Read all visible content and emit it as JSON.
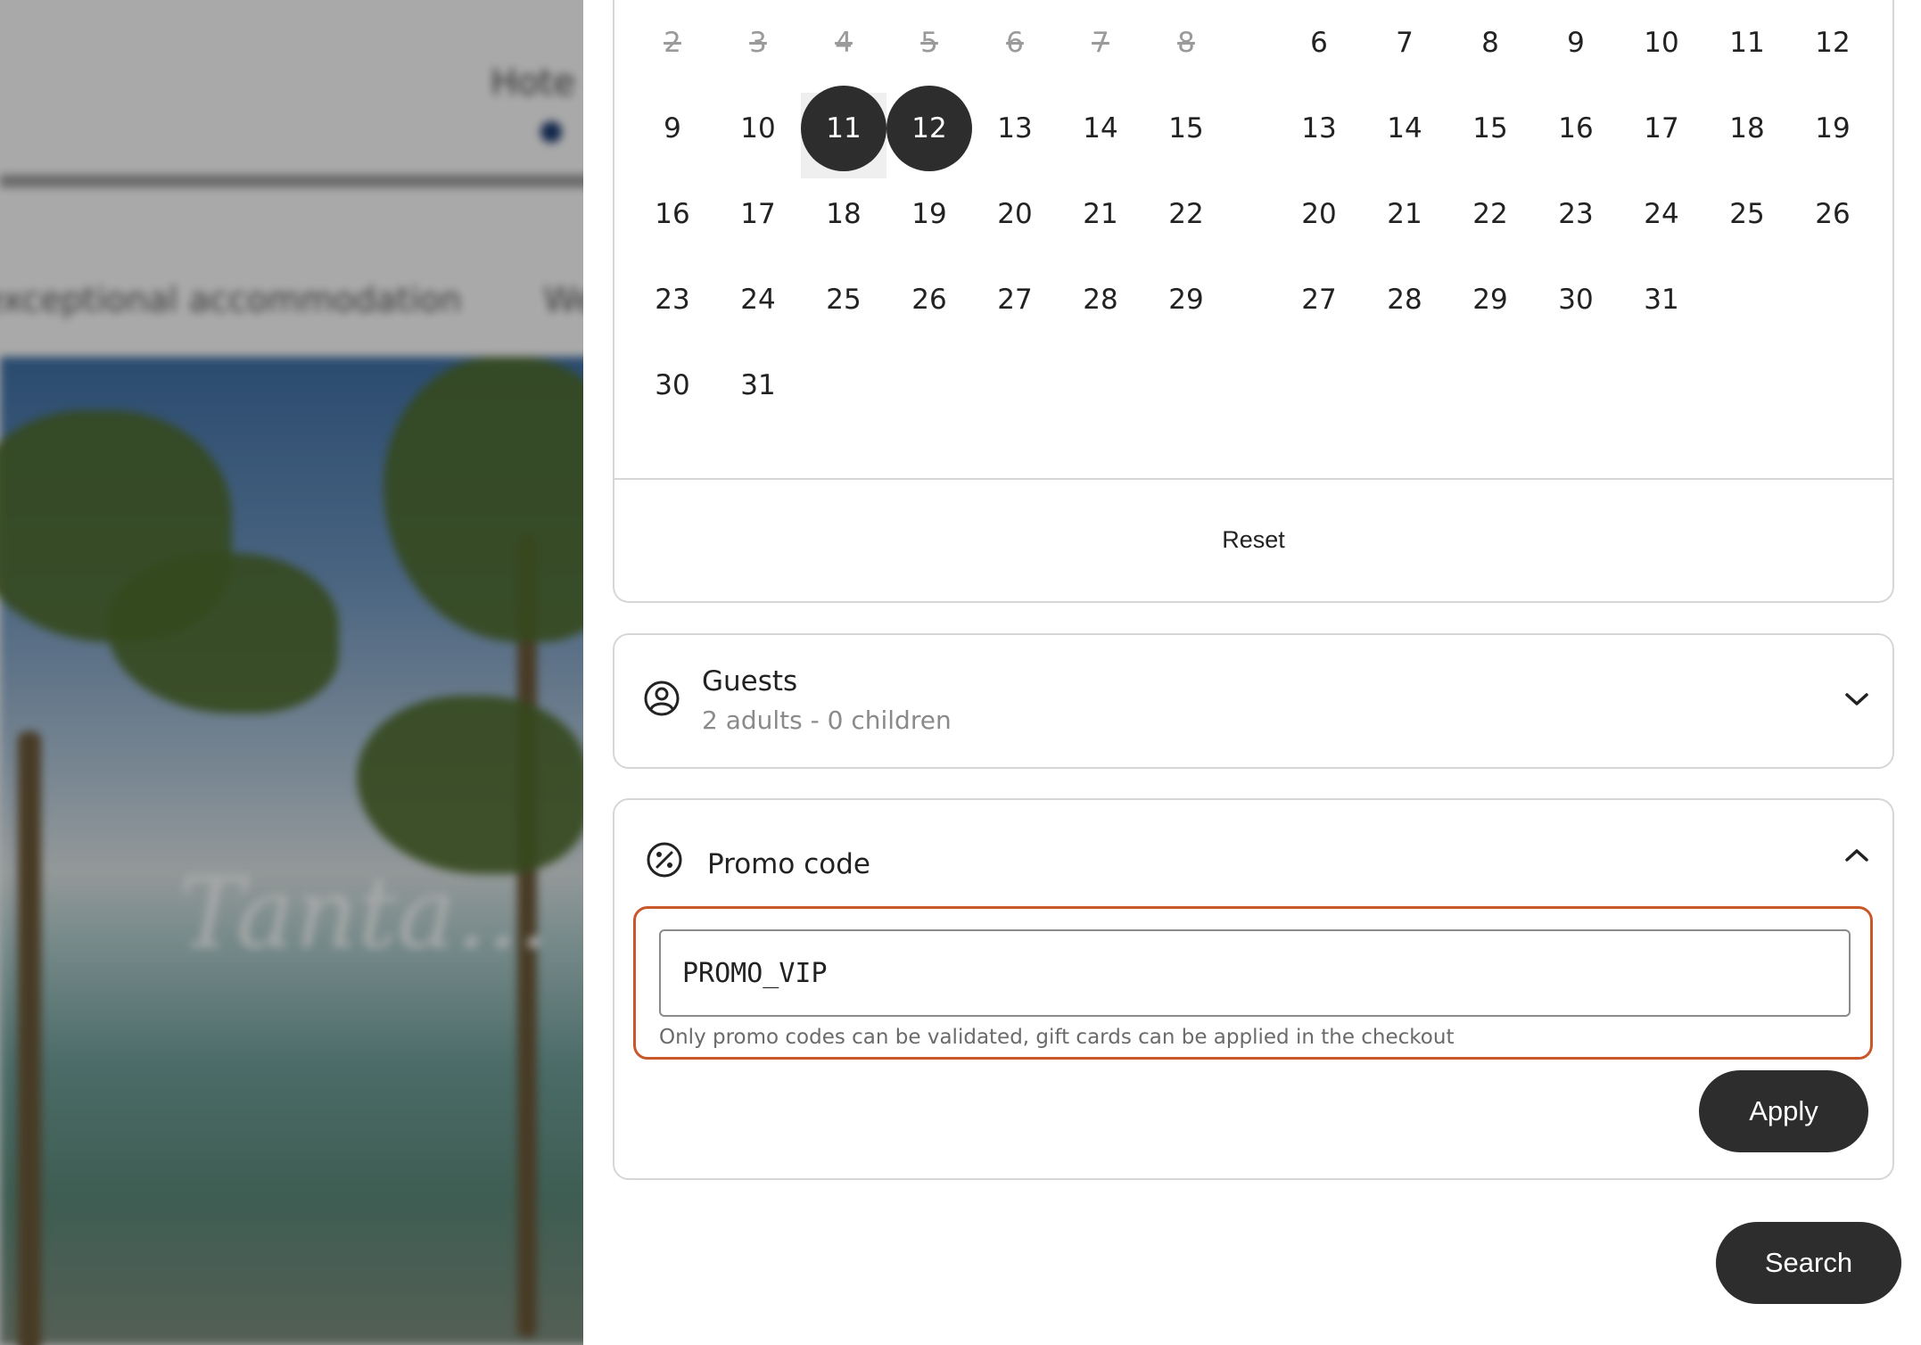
{
  "background_page": {
    "header_text": "Hote",
    "nav_items": [
      "exceptional accommodation",
      "Wel"
    ],
    "hero_title": "Tanta..."
  },
  "calendar": {
    "left_month": {
      "weeks": [
        [
          {
            "d": "2",
            "disabled": true
          },
          {
            "d": "3",
            "disabled": true
          },
          {
            "d": "4",
            "disabled": true
          },
          {
            "d": "5",
            "disabled": true
          },
          {
            "d": "6",
            "disabled": true
          },
          {
            "d": "7",
            "disabled": true
          },
          {
            "d": "8",
            "disabled": true
          }
        ],
        [
          {
            "d": "9"
          },
          {
            "d": "10"
          },
          {
            "d": "11",
            "selected": true
          },
          {
            "d": "12",
            "selected": true
          },
          {
            "d": "13"
          },
          {
            "d": "14"
          },
          {
            "d": "15"
          }
        ],
        [
          {
            "d": "16"
          },
          {
            "d": "17"
          },
          {
            "d": "18"
          },
          {
            "d": "19"
          },
          {
            "d": "20"
          },
          {
            "d": "21"
          },
          {
            "d": "22"
          }
        ],
        [
          {
            "d": "23"
          },
          {
            "d": "24"
          },
          {
            "d": "25"
          },
          {
            "d": "26"
          },
          {
            "d": "27"
          },
          {
            "d": "28"
          },
          {
            "d": "29"
          }
        ],
        [
          {
            "d": "30"
          },
          {
            "d": "31"
          }
        ]
      ]
    },
    "right_month": {
      "weeks": [
        [
          {
            "d": "6"
          },
          {
            "d": "7"
          },
          {
            "d": "8"
          },
          {
            "d": "9"
          },
          {
            "d": "10"
          },
          {
            "d": "11"
          },
          {
            "d": "12"
          }
        ],
        [
          {
            "d": "13"
          },
          {
            "d": "14"
          },
          {
            "d": "15"
          },
          {
            "d": "16"
          },
          {
            "d": "17"
          },
          {
            "d": "18"
          },
          {
            "d": "19"
          }
        ],
        [
          {
            "d": "20"
          },
          {
            "d": "21"
          },
          {
            "d": "22"
          },
          {
            "d": "23"
          },
          {
            "d": "24"
          },
          {
            "d": "25"
          },
          {
            "d": "26"
          }
        ],
        [
          {
            "d": "27"
          },
          {
            "d": "28"
          },
          {
            "d": "29"
          },
          {
            "d": "30"
          },
          {
            "d": "31"
          }
        ]
      ]
    },
    "reset_label": "Reset"
  },
  "guests": {
    "title": "Guests",
    "summary": "2 adults - 0 children",
    "icon": "user-circle-icon"
  },
  "promo": {
    "title": "Promo code",
    "icon": "percent-badge-icon",
    "value": "PROMO_VIP",
    "help_text": "Only promo codes can be validated, gift cards can be applied in the checkout",
    "apply_label": "Apply",
    "error_color": "#c8582a"
  },
  "search_label": "Search",
  "colors": {
    "primary_button": "#2d2d2d",
    "border": "#d6d6d6"
  }
}
